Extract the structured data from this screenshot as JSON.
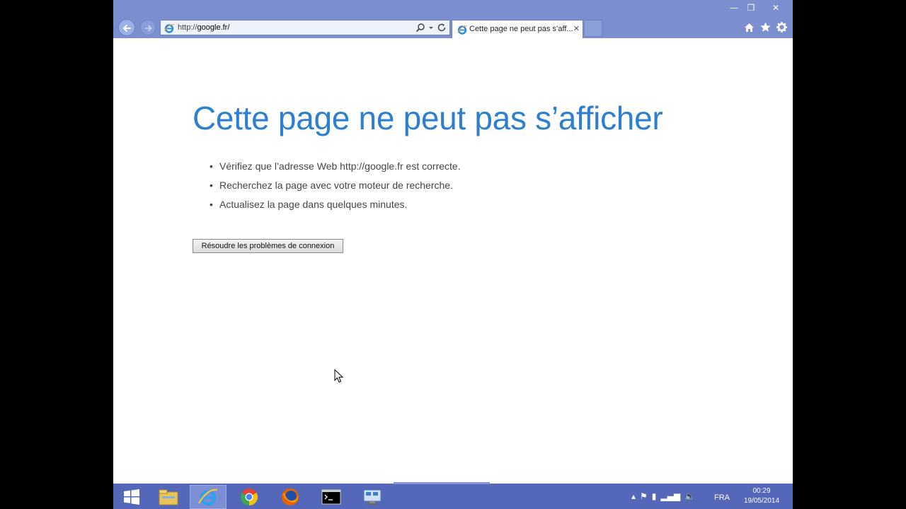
{
  "window": {
    "minimize_glyph": "—",
    "maximize_glyph": "❐",
    "close_glyph": "✕"
  },
  "address_bar": {
    "url_prefix": "http://",
    "url_host": "google.fr/",
    "search_icon": "magnifier-icon",
    "refresh_icon": "refresh-icon"
  },
  "tab": {
    "title": "Cette page ne peut pas s’aff...",
    "close_glyph": "✕"
  },
  "toolbar_icons": [
    "home-icon",
    "favorites-star-icon",
    "settings-gear-icon"
  ],
  "error_page": {
    "title": "Cette page ne peut pas s’afficher",
    "bullets": [
      "Vérifiez que l’adresse Web http://google.fr est correcte.",
      "Recherchez la page avec votre moteur de recherche.",
      "Actualisez la page dans quelques minutes."
    ],
    "fix_button": "Résoudre les problèmes de connexion"
  },
  "taskbar": {
    "items": [
      "start-icon",
      "file-explorer-icon",
      "internet-explorer-icon",
      "chrome-icon",
      "firefox-icon",
      "command-prompt-icon",
      "network-tool-icon"
    ],
    "active_item": "internet-explorer-icon",
    "language": "FRA",
    "time": "00:29",
    "date": "19/05/2014"
  },
  "colors": {
    "chrome_blue": "#7b8fd0",
    "title_blue": "#2d7fcf",
    "taskbar_blue": "#5467b9"
  }
}
